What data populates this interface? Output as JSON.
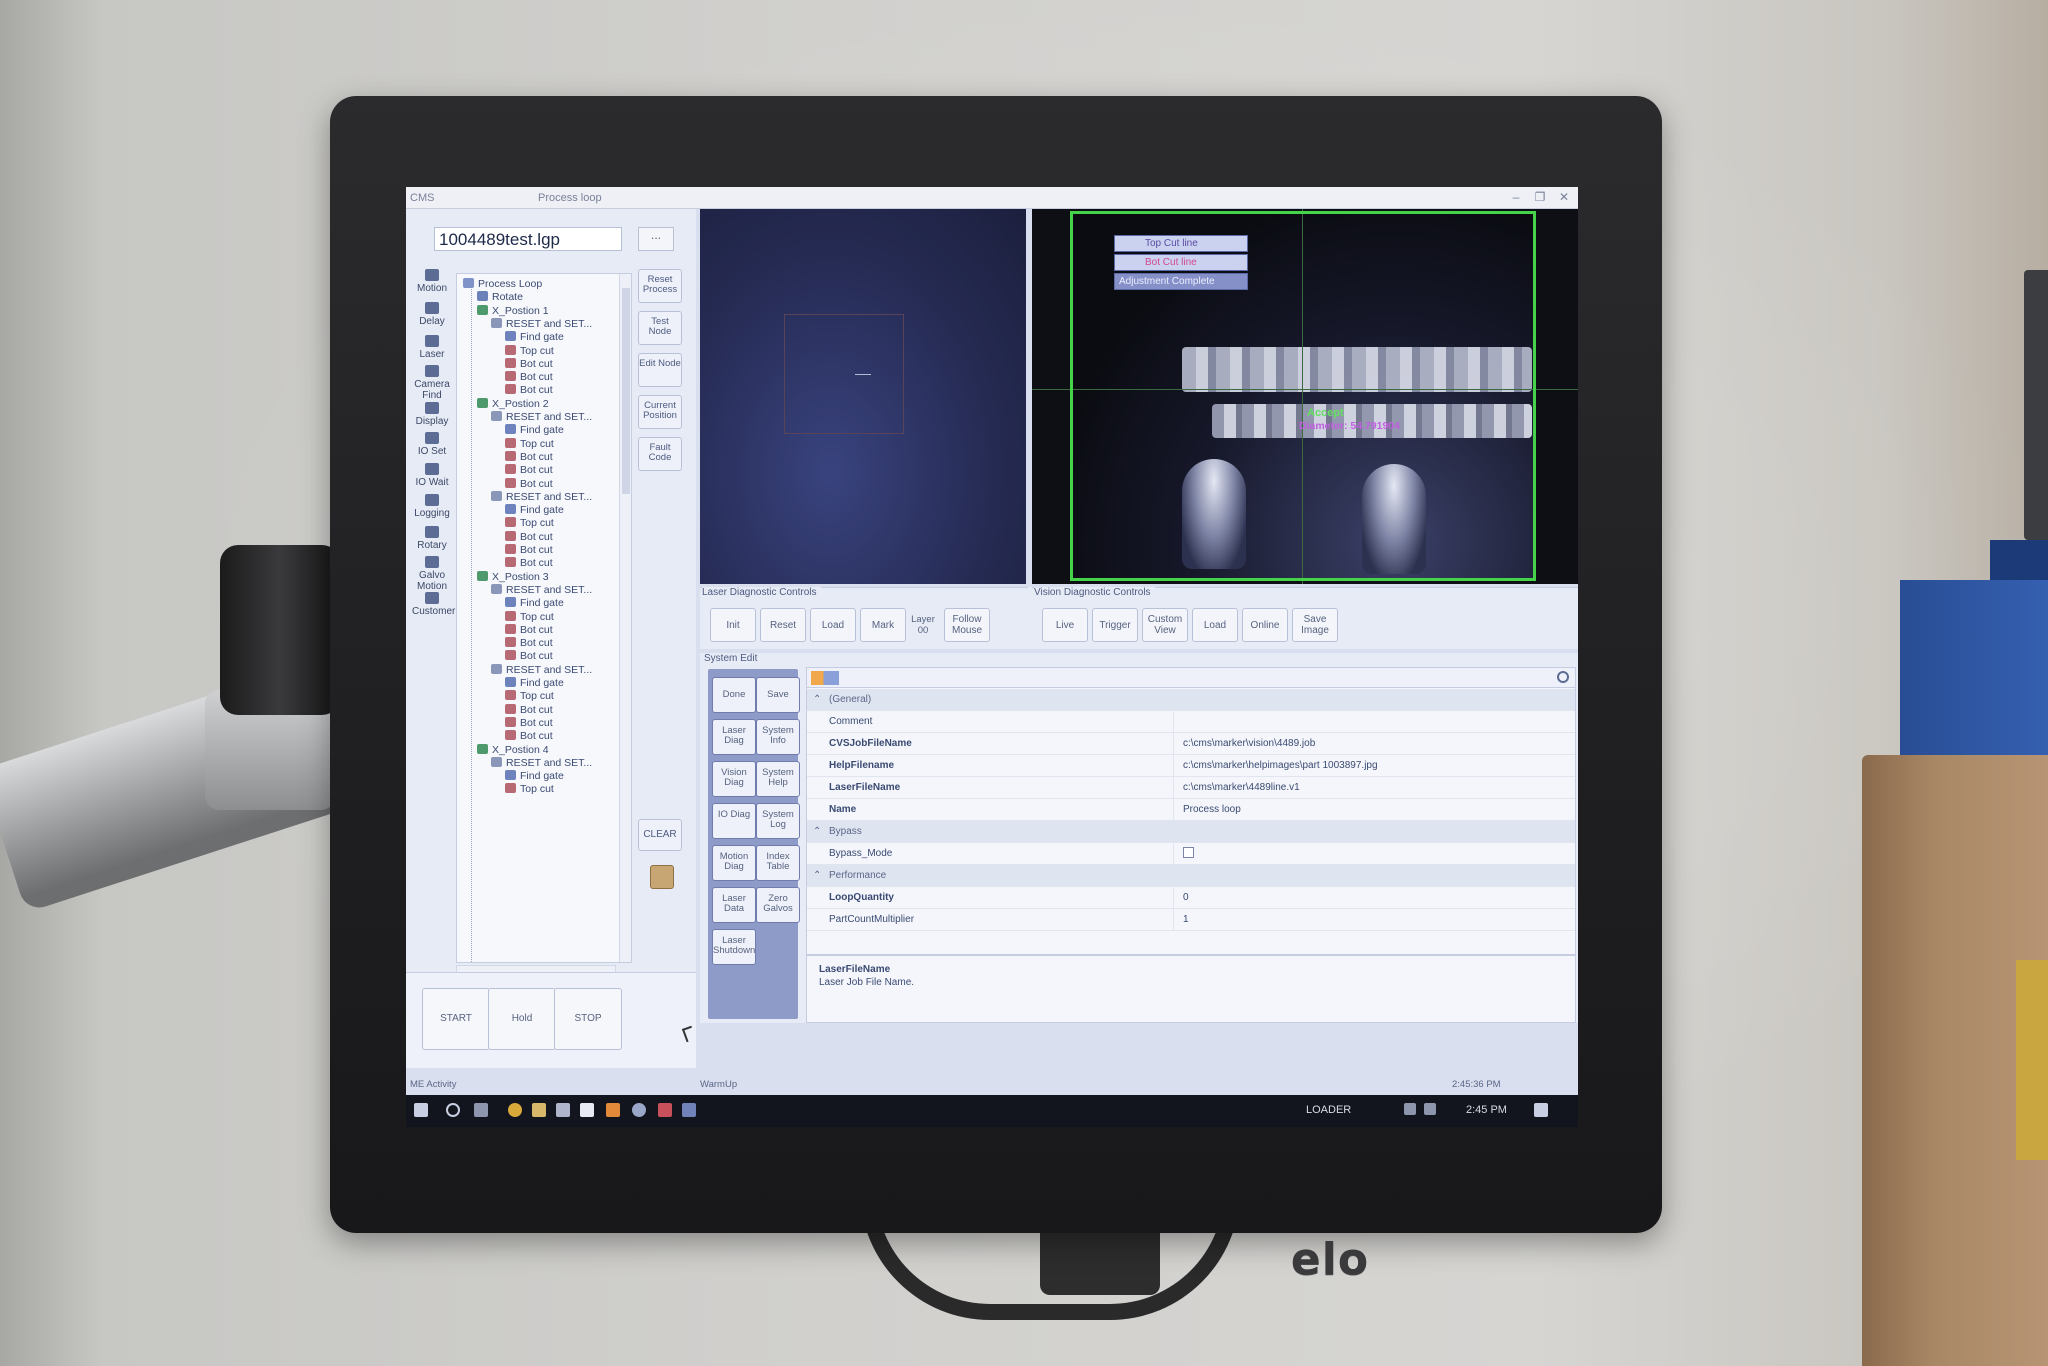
{
  "app": {
    "title": "CMS",
    "window_title": "Process loop",
    "minimize": "–",
    "restore": "❐",
    "close": "✕"
  },
  "file": {
    "name": "1004489test.lgp",
    "browse": "..."
  },
  "tools": [
    "Motion",
    "Delay",
    "Laser",
    "Camera Find",
    "Display",
    "IO Set",
    "IO Wait",
    "Logging",
    "Rotary",
    "Galvo Motion",
    "Customer"
  ],
  "tree": [
    {
      "label": "Process Loop",
      "icon": "proc",
      "level": 0
    },
    {
      "label": "Rotate",
      "icon": "rot",
      "level": 1
    },
    {
      "label": "X_Postion 1",
      "icon": "xpos",
      "level": 1
    },
    {
      "label": "RESET and SET...",
      "icon": "reset",
      "level": 2
    },
    {
      "label": "Find gate",
      "icon": "find",
      "level": 3
    },
    {
      "label": "Top cut",
      "icon": "cut",
      "level": 3
    },
    {
      "label": "Bot cut",
      "icon": "cut",
      "level": 3
    },
    {
      "label": "Bot cut",
      "icon": "cut",
      "level": 3
    },
    {
      "label": "Bot cut",
      "icon": "cut",
      "level": 3
    },
    {
      "label": "X_Postion 2",
      "icon": "xpos",
      "level": 1
    },
    {
      "label": "RESET and SET...",
      "icon": "reset",
      "level": 2
    },
    {
      "label": "Find gate",
      "icon": "find",
      "level": 3
    },
    {
      "label": "Top cut",
      "icon": "cut",
      "level": 3
    },
    {
      "label": "Bot cut",
      "icon": "cut",
      "level": 3
    },
    {
      "label": "Bot cut",
      "icon": "cut",
      "level": 3
    },
    {
      "label": "Bot cut",
      "icon": "cut",
      "level": 3
    },
    {
      "label": "RESET and SET...",
      "icon": "reset",
      "level": 2
    },
    {
      "label": "Find gate",
      "icon": "find",
      "level": 3
    },
    {
      "label": "Top cut",
      "icon": "cut",
      "level": 3
    },
    {
      "label": "Bot cut",
      "icon": "cut",
      "level": 3
    },
    {
      "label": "Bot cut",
      "icon": "cut",
      "level": 3
    },
    {
      "label": "Bot cut",
      "icon": "cut",
      "level": 3
    },
    {
      "label": "X_Postion 3",
      "icon": "xpos",
      "level": 1
    },
    {
      "label": "RESET and SET...",
      "icon": "reset",
      "level": 2
    },
    {
      "label": "Find gate",
      "icon": "find",
      "level": 3
    },
    {
      "label": "Top cut",
      "icon": "cut",
      "level": 3
    },
    {
      "label": "Bot cut",
      "icon": "cut",
      "level": 3
    },
    {
      "label": "Bot cut",
      "icon": "cut",
      "level": 3
    },
    {
      "label": "Bot cut",
      "icon": "cut",
      "level": 3
    },
    {
      "label": "RESET and SET...",
      "icon": "reset",
      "level": 2
    },
    {
      "label": "Find gate",
      "icon": "find",
      "level": 3
    },
    {
      "label": "Top cut",
      "icon": "cut",
      "level": 3
    },
    {
      "label": "Bot cut",
      "icon": "cut",
      "level": 3
    },
    {
      "label": "Bot cut",
      "icon": "cut",
      "level": 3
    },
    {
      "label": "Bot cut",
      "icon": "cut",
      "level": 3
    },
    {
      "label": "X_Postion 4",
      "icon": "xpos",
      "level": 1
    },
    {
      "label": "RESET and SET...",
      "icon": "reset",
      "level": 2
    },
    {
      "label": "Find gate",
      "icon": "find",
      "level": 3
    },
    {
      "label": "Top cut",
      "icon": "cut",
      "level": 3
    }
  ],
  "side_buttons": [
    "Reset Process",
    "Test Node",
    "Edit Node",
    "Current Position",
    "Fault Code"
  ],
  "clear": "CLEAR",
  "run": {
    "start": "START",
    "hold": "Hold",
    "stop": "STOP"
  },
  "vision_overlay": {
    "top_cut": "Top Cut line",
    "bot_cut": "Bot Cut line",
    "adjust": "Adjustment Complete",
    "accept": "Accept",
    "diameter": "Diameter: 54.791904"
  },
  "laser_controls": {
    "label": "Laser Diagnostic Controls",
    "buttons": [
      "Init",
      "Reset",
      "Load",
      "Mark"
    ],
    "layer_label": "Layer",
    "layer_value": "00",
    "follow": "Follow Mouse"
  },
  "vision_controls": {
    "label": "Vision Diagnostic Controls",
    "buttons": [
      "Live",
      "Trigger",
      "Custom View",
      "Load",
      "Online",
      "Save Image"
    ]
  },
  "system_edit": {
    "label": "System Edit",
    "buttons": [
      "Done",
      "Save",
      "Laser Diag",
      "System Info",
      "Vision Diag",
      "System Help",
      "IO Diag",
      "System Log",
      "Motion Diag",
      "Index Table",
      "Laser Data",
      "Zero Galvos",
      "Laser Shutdown"
    ]
  },
  "properties": [
    {
      "type": "cat",
      "name": "(General)"
    },
    {
      "type": "row",
      "name": "Comment",
      "value": ""
    },
    {
      "type": "row",
      "name": "CVSJobFileName",
      "value": "c:\\cms\\marker\\vision\\4489.job",
      "bold": true
    },
    {
      "type": "row",
      "name": "HelpFilename",
      "value": "c:\\cms\\marker\\helpimages\\part 1003897.jpg",
      "bold": true
    },
    {
      "type": "row",
      "name": "LaserFileName",
      "value": "c:\\cms\\marker\\4489line.v1",
      "bold": true
    },
    {
      "type": "row",
      "name": "Name",
      "value": "Process loop",
      "bold": true
    },
    {
      "type": "cat",
      "name": "Bypass"
    },
    {
      "type": "row",
      "name": "Bypass_Mode",
      "value": "",
      "check": true
    },
    {
      "type": "cat",
      "name": "Performance"
    },
    {
      "type": "row",
      "name": "LoopQuantity",
      "value": "0",
      "bold": true
    },
    {
      "type": "row",
      "name": "PartCountMultiplier",
      "value": "1"
    }
  ],
  "description": {
    "title": "LaserFileName",
    "text": "Laser Job File Name."
  },
  "status": {
    "left": "ME Activity",
    "mid": "WarmUp",
    "time": "2:45:36 PM"
  },
  "taskbar": {
    "loader": "LOADER",
    "clock": "2:45 PM"
  },
  "brand": "elo",
  "colors": {
    "accept": "#64e062",
    "diameter": "#c25ee0",
    "frame": "#45d34a",
    "panel": "#e7ebf6"
  }
}
